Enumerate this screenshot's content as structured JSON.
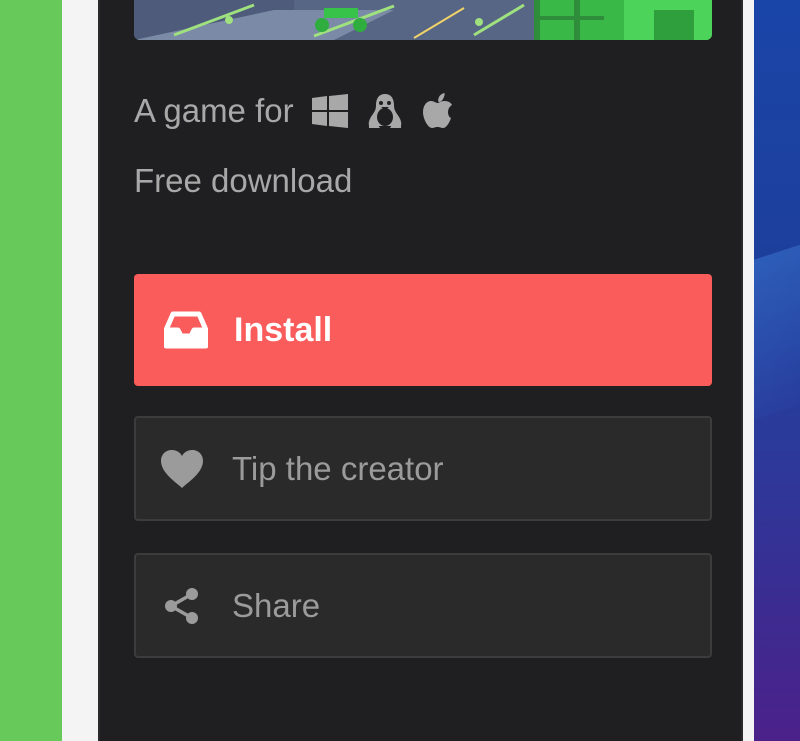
{
  "game": {
    "platforms_prefix": "A game for",
    "platform_icons": [
      "windows-icon",
      "linux-icon",
      "apple-icon"
    ],
    "price_text": "Free download"
  },
  "actions": {
    "install_label": "Install",
    "tip_label": "Tip the creator",
    "share_label": "Share"
  },
  "colors": {
    "install_button": "#fa5c5c",
    "panel_background": "#1f1e20",
    "secondary_button": "#2a2a2a",
    "muted_text": "#a8a8a8"
  }
}
